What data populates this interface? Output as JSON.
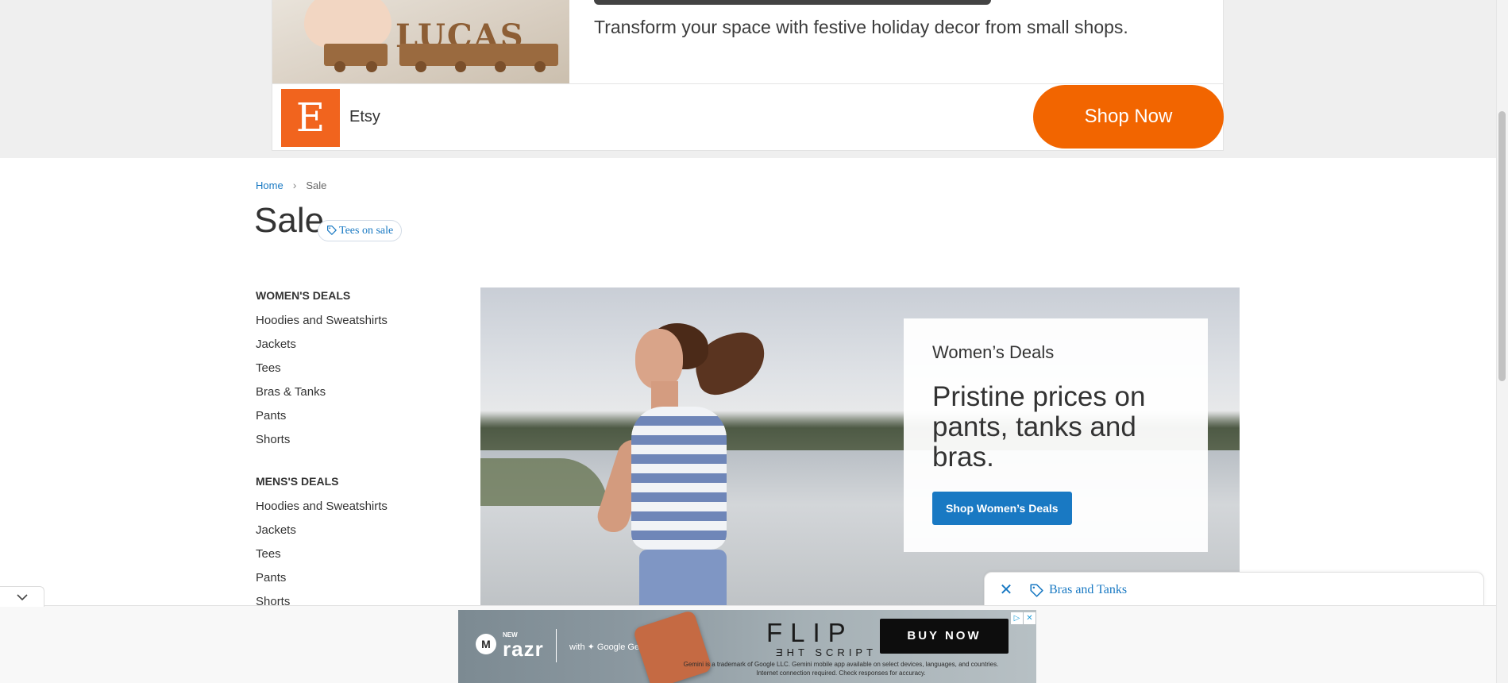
{
  "top_ad": {
    "subtitle": "Transform your space with festive holiday decor from small shops.",
    "photo_letters": "LUCAS",
    "logo_letter": "E",
    "brand": "Etsy",
    "cta": "Shop Now"
  },
  "breadcrumb": {
    "home": "Home",
    "current": "Sale"
  },
  "page": {
    "title": "Sale",
    "tag_chip": "Tees on sale"
  },
  "sidebar": {
    "womens": {
      "heading": "WOMEN'S DEALS",
      "items": [
        "Hoodies and Sweatshirts",
        "Jackets",
        "Tees",
        "Bras & Tanks",
        "Pants",
        "Shorts"
      ]
    },
    "mens": {
      "heading": "MENS'S DEALS",
      "items": [
        "Hoodies and Sweatshirts",
        "Jackets",
        "Tees",
        "Pants",
        "Shorts"
      ]
    }
  },
  "hero": {
    "eyebrow": "Women’s Deals",
    "heading": "Pristine prices on pants, tanks and bras.",
    "button": "Shop Women’s Deals"
  },
  "floating_tag": {
    "label": "Bras and Tanks"
  },
  "bottom_ad": {
    "new": "NEW",
    "product": "razr",
    "partner": "with ✦ Google Gemini",
    "headline_1": "FLIP",
    "headline_2": "ƎHT SCRIPT",
    "cta": "BUY NOW",
    "fine_print": "Gemini is a trademark of Google LLC. Gemini mobile app available on select devices, languages, and countries. Internet connection required. Check responses for accuracy."
  },
  "colors": {
    "link": "#1979c3",
    "etsy_orange": "#f1641e",
    "shop_now": "#f26500"
  }
}
